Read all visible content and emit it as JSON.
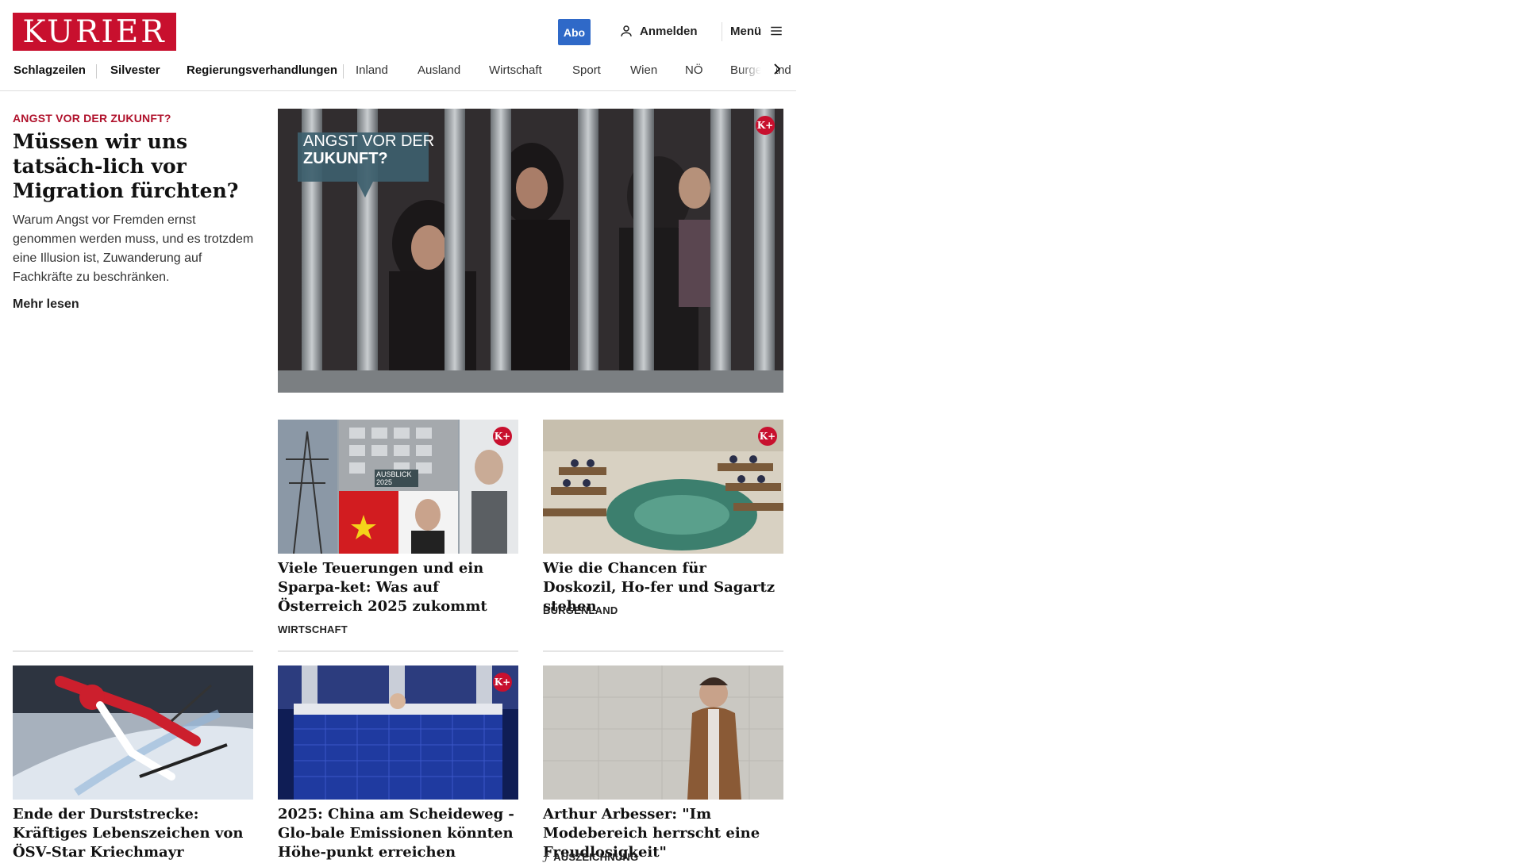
{
  "header": {
    "logo": "KURIER",
    "abo_label": "Abo",
    "login_label": "Anmelden",
    "menu_label": "Menü"
  },
  "nav": {
    "items": [
      "Schlagzeilen",
      "Silvester",
      "Regierungsverhandlungen",
      "Inland",
      "Ausland",
      "Wirtschaft",
      "Sport",
      "Wien",
      "NÖ",
      "Burgenland"
    ]
  },
  "lead": {
    "kicker": "ANGST VOR DER ZUKUNFT?",
    "title": "Müssen wir uns tatsäch-lich vor Migration fürchten?",
    "teaser": "Warum Angst vor Fremden ernst genommen werden muss, und es trotzdem eine Illusion ist, Zuwanderung auf Fachkräfte zu beschränken.",
    "more": "Mehr lesen",
    "image_caption": "ANGST VOR DER",
    "image_caption2": "ZUKUNFT?"
  },
  "cards": [
    {
      "title": "Viele Teuerungen und ein Sparpa-ket: Was auf Österreich 2025 zukommt",
      "category": "WIRTSCHAFT",
      "badge": "AUSBLICK 2025"
    },
    {
      "title": "Wie die Chancen für Doskozil, Ho-fer und Sagartz stehen",
      "category": "BURGENLAND"
    },
    {
      "title": "Ende der Durststrecke: Kräftiges Lebenszeichen von ÖSV-Star Kriechmayr",
      "category": ""
    },
    {
      "title": "2025: China am Scheideweg - Glo-bale Emissionen könnten Höhe-punkt erreichen",
      "category": ""
    },
    {
      "title": "Arthur Arbesser: \"Im Modebereich herrscht eine Freudlosigkeit\"",
      "category": "AUSZEICHNUNG"
    }
  ],
  "colors": {
    "brand": "#c8102e",
    "abo": "#2f69c8",
    "kicker": "#b0122c"
  },
  "kplus_label": "K+"
}
